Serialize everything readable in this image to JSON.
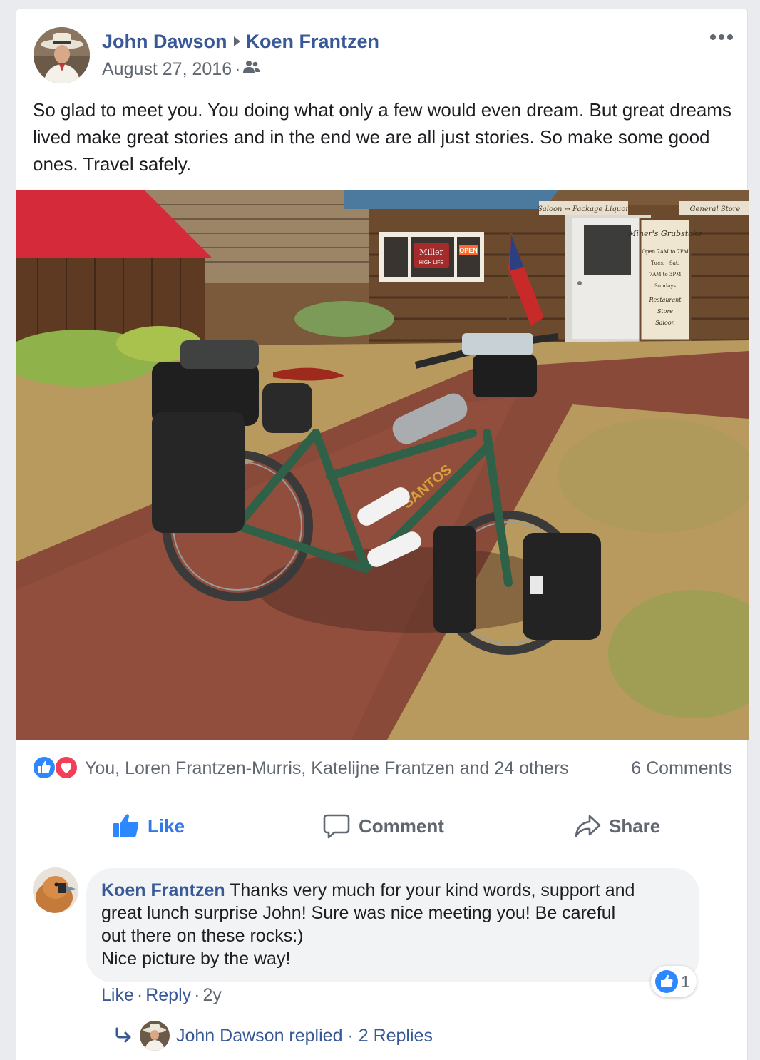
{
  "post": {
    "author": "John Dawson",
    "recipient": "Koen Frantzen",
    "date": "August 27, 2016",
    "date_separator": "·",
    "audience_icon": "friends-icon",
    "more_icon": "ellipsis-icon",
    "text": "So glad to meet you. You doing what only a few would even dream. But great dreams lived make great stories and in the end we are all just stories. So make some good ones. Travel safely."
  },
  "photo": {
    "signs": {
      "saloon": "Saloon ↔ Package Liquor",
      "general_store": "General Store",
      "window_beer": "Miller",
      "window_beer_sub": "HIGH LIFE",
      "window_open": "OPEN",
      "door_board_title": "Miner's Grubstake",
      "door_board_lines": [
        "Open 7AM to 7PM",
        "Tues. - Sat.",
        "7AM to 3PM",
        "Sundays",
        "Restaurant",
        "Store",
        "Saloon"
      ],
      "bike_brand": "SANTOS"
    }
  },
  "reactions": {
    "icons": [
      "like-icon",
      "love-icon"
    ],
    "names": "You, Loren Frantzen-Murris, Katelijne Frantzen and 24 others",
    "comments": "6 Comments"
  },
  "actions": {
    "like": "Like",
    "comment": "Comment",
    "share": "Share"
  },
  "comment": {
    "author": "Koen Frantzen",
    "line1": "Thanks very much for your kind words, support and",
    "line2": "great lunch surprise John! Sure was nice meeting you! Be careful",
    "line3": "out there on these rocks:)",
    "line4": "Nice picture by the way!",
    "reaction_count": "1",
    "like_label": "Like",
    "reply_label": "Reply",
    "separator": "·",
    "age": "2y"
  },
  "replies": {
    "text": "John Dawson replied",
    "separator": "·",
    "count": "2 Replies"
  },
  "colors": {
    "link": "#385898",
    "like_blue": "#2d88ff",
    "love_red": "#f33e58",
    "muted": "#606770"
  }
}
